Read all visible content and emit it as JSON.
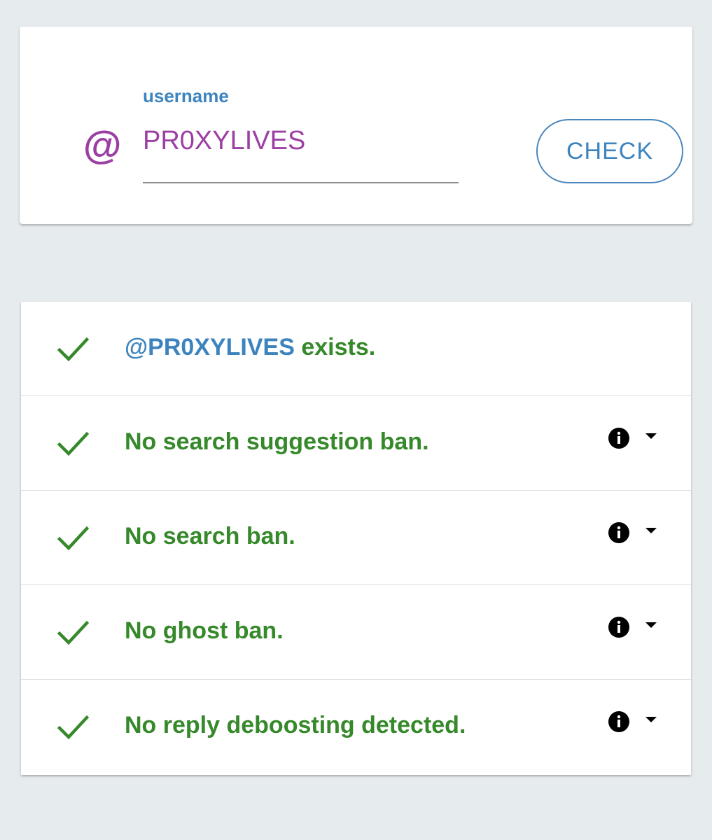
{
  "search": {
    "at_symbol": "@",
    "label": "username",
    "value": "PR0XYLIVES",
    "button_label": "CHECK"
  },
  "results": {
    "handle": "@PR0XYLIVES",
    "exists_suffix": " exists.",
    "items": [
      {
        "label": "No search suggestion ban.",
        "icon": "check-icon",
        "has_info": true
      },
      {
        "label": "No search ban.",
        "icon": "check-icon",
        "has_info": true
      },
      {
        "label": "No ghost ban.",
        "icon": "check-icon",
        "has_info": true
      },
      {
        "label": "No reply deboosting detected.",
        "icon": "check-icon",
        "has_info": true
      }
    ]
  },
  "colors": {
    "accent_purple": "#9c3fa3",
    "accent_blue": "#3d84bf",
    "success_green": "#36892b",
    "background": "#e6ebee"
  }
}
